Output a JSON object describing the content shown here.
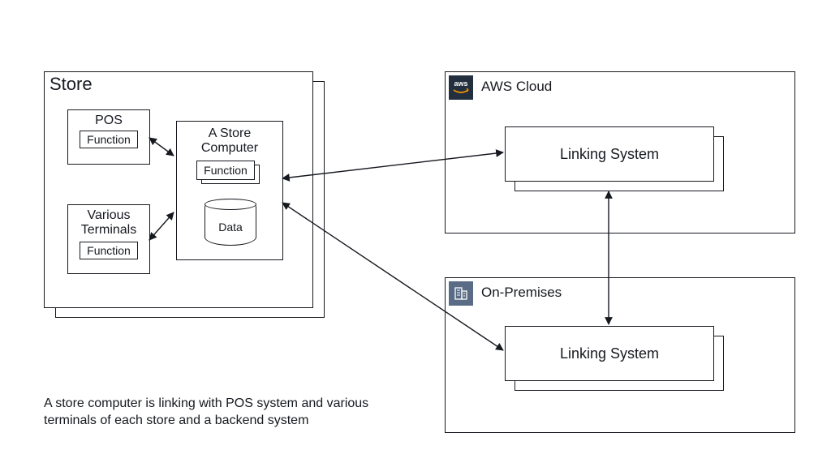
{
  "store": {
    "title": "Store",
    "pos": {
      "title": "POS",
      "function": "Function"
    },
    "terminals": {
      "title": "Various\nTerminals",
      "function": "Function"
    },
    "computer": {
      "title": "A Store\nComputer",
      "function": "Function",
      "data": "Data"
    }
  },
  "cloud": {
    "icon_text": "aws",
    "title": "AWS Cloud",
    "linking": "Linking System"
  },
  "onprem": {
    "title": "On-Premises",
    "linking": "Linking System"
  },
  "caption": "A store computer is linking with POS system and various terminals of each store and a backend system"
}
